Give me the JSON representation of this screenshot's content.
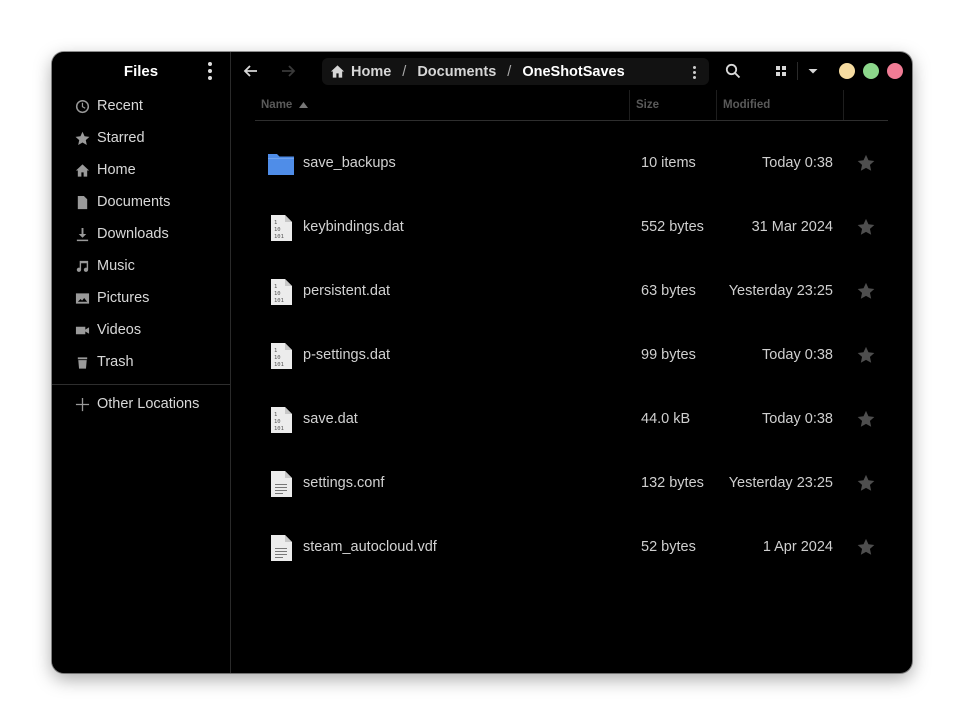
{
  "app": {
    "title": "Files"
  },
  "colors": {
    "accent_folder": "#4f8de8",
    "window_close": "#f07c95",
    "window_maximize": "#8cd78b",
    "window_minimize": "#f6dca1"
  },
  "sidebar": {
    "title": "Files",
    "menu_icon": "vertical-dots-icon",
    "items": [
      {
        "label": "Recent",
        "icon": "clock-icon"
      },
      {
        "label": "Starred",
        "icon": "star-icon"
      },
      {
        "label": "Home",
        "icon": "home-icon"
      },
      {
        "label": "Documents",
        "icon": "document-icon"
      },
      {
        "label": "Downloads",
        "icon": "download-icon"
      },
      {
        "label": "Music",
        "icon": "music-icon"
      },
      {
        "label": "Pictures",
        "icon": "picture-icon"
      },
      {
        "label": "Videos",
        "icon": "video-icon"
      },
      {
        "label": "Trash",
        "icon": "trash-icon"
      }
    ],
    "other_locations": {
      "label": "Other Locations",
      "icon": "plus-icon"
    }
  },
  "toolbar": {
    "back_icon": "arrow-left-icon",
    "forward_icon": "arrow-right-icon",
    "breadcrumb": [
      {
        "label": "Home",
        "icon": "home-icon"
      },
      {
        "label": "Documents"
      },
      {
        "label": "OneShotSaves"
      }
    ],
    "separator": "/",
    "search_icon": "search-icon",
    "view_icon": "grid-icon",
    "view_dropdown_icon": "caret-down-icon"
  },
  "list": {
    "columns": {
      "name": "Name",
      "size": "Size",
      "modified": "Modified"
    },
    "sort": {
      "column": "Name",
      "direction": "ascending"
    },
    "rows": [
      {
        "name": "save_backups",
        "size": "10 items",
        "modified": "Today 0:38",
        "type": "folder",
        "starred": false
      },
      {
        "name": "keybindings.dat",
        "size": "552 bytes",
        "modified": "31 Mar 2024",
        "type": "binary",
        "starred": false
      },
      {
        "name": "persistent.dat",
        "size": "63 bytes",
        "modified": "Yesterday 23:25",
        "type": "binary",
        "starred": false
      },
      {
        "name": "p-settings.dat",
        "size": "99 bytes",
        "modified": "Today 0:38",
        "type": "binary",
        "starred": false
      },
      {
        "name": "save.dat",
        "size": "44.0 kB",
        "modified": "Today 0:38",
        "type": "binary",
        "starred": false
      },
      {
        "name": "settings.conf",
        "size": "132 bytes",
        "modified": "Yesterday 23:25",
        "type": "text",
        "starred": false
      },
      {
        "name": "steam_autocloud.vdf",
        "size": "52 bytes",
        "modified": "1 Apr 2024",
        "type": "text",
        "starred": false
      }
    ]
  }
}
